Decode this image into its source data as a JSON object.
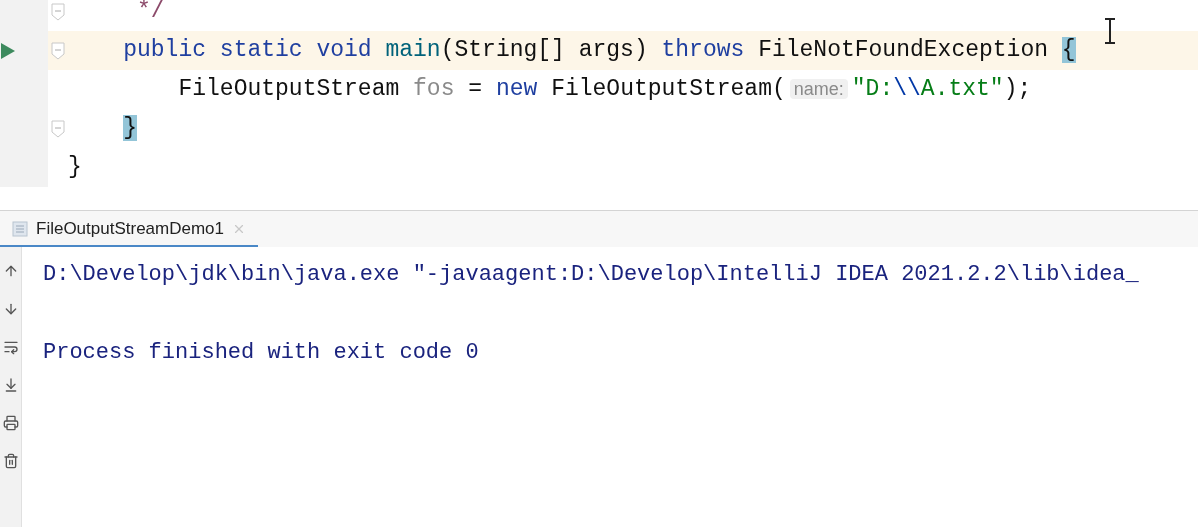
{
  "editor": {
    "lines": [
      {
        "current": false,
        "run": false,
        "fold": true,
        "tokens": [
          {
            "kind": "comment",
            "text": "     */"
          }
        ]
      },
      {
        "current": true,
        "run": true,
        "fold": true,
        "tokens": [
          {
            "kind": "keyword",
            "text": "    public static void "
          },
          {
            "kind": "method",
            "text": "main"
          },
          {
            "kind": "plain",
            "text": "(String[] args) "
          },
          {
            "kind": "keyword",
            "text": "throws"
          },
          {
            "kind": "plain",
            "text": " FileNotFoundException "
          },
          {
            "kind": "match",
            "text": "{"
          }
        ]
      },
      {
        "current": false,
        "run": false,
        "fold": false,
        "tokens": [
          {
            "kind": "plain",
            "text": "        FileOutputStream "
          },
          {
            "kind": "unused",
            "text": "fos"
          },
          {
            "kind": "plain",
            "text": " = "
          },
          {
            "kind": "keyword",
            "text": "new"
          },
          {
            "kind": "plain",
            "text": " FileOutputStream("
          },
          {
            "kind": "hint",
            "text": "name:"
          },
          {
            "kind": "string",
            "text": "\"D:"
          },
          {
            "kind": "escape",
            "text": "\\\\"
          },
          {
            "kind": "string",
            "text": "A.txt\""
          },
          {
            "kind": "plain",
            "text": ");"
          }
        ]
      },
      {
        "current": false,
        "run": false,
        "fold": true,
        "tokens": [
          {
            "kind": "match",
            "text": "    }"
          }
        ]
      },
      {
        "current": false,
        "run": false,
        "fold": false,
        "tokens": [
          {
            "kind": "plain",
            "text": "}"
          }
        ]
      }
    ]
  },
  "console": {
    "tabs": [
      {
        "label": "FileOutputStreamDemo1",
        "selected": true
      }
    ],
    "lines": [
      "D:\\Develop\\jdk\\bin\\java.exe \"-javaagent:D:\\Develop\\IntelliJ IDEA 2021.2.2\\lib\\idea_",
      "Process finished with exit code 0"
    ]
  }
}
